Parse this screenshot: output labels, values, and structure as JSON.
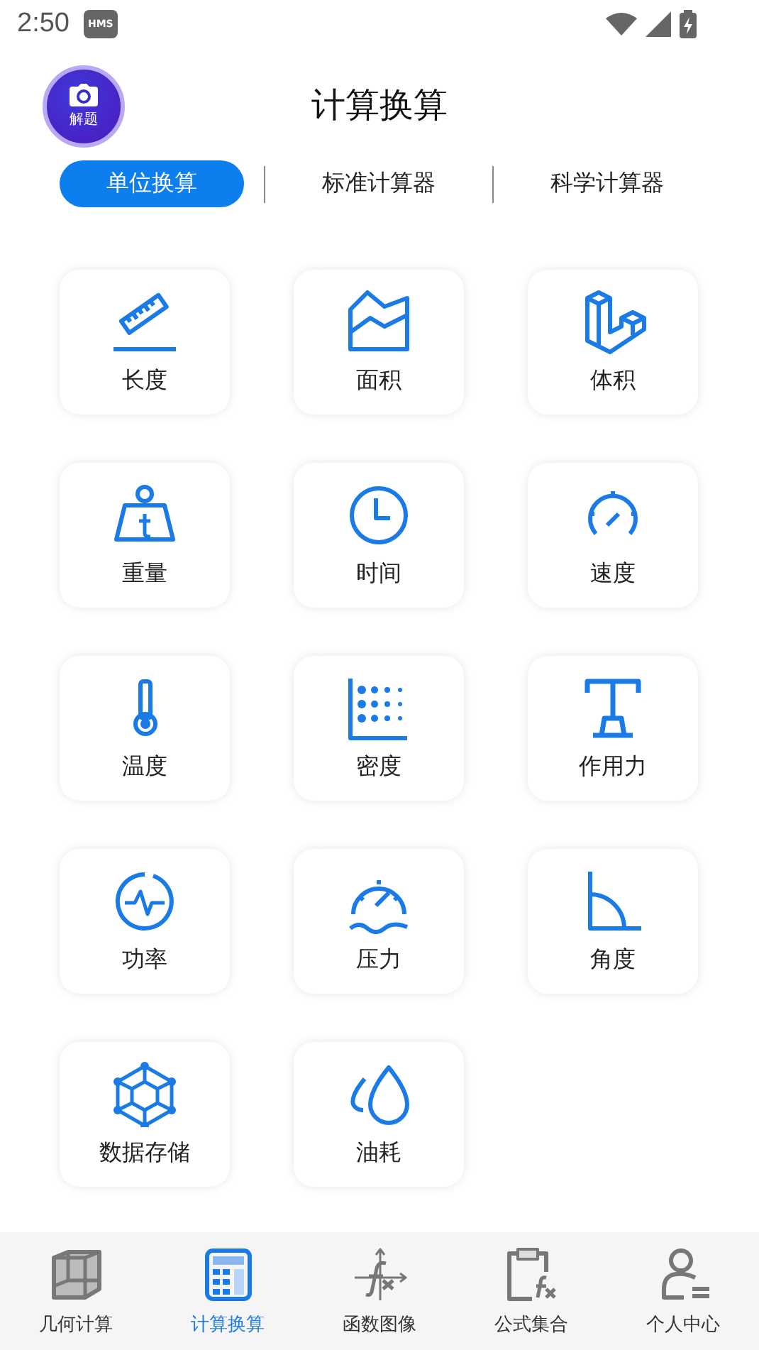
{
  "status_bar": {
    "time": "2:50",
    "badge": "HMS"
  },
  "header": {
    "title": "计算换算",
    "camera_button": {
      "label": "解题"
    }
  },
  "tabs": [
    {
      "label": "单位换算",
      "selected": true
    },
    {
      "label": "标准计算器",
      "selected": false
    },
    {
      "label": "科学计算器",
      "selected": false
    }
  ],
  "tiles": [
    {
      "label": "长度"
    },
    {
      "label": "面积"
    },
    {
      "label": "体积"
    },
    {
      "label": "重量"
    },
    {
      "label": "时间"
    },
    {
      "label": "速度"
    },
    {
      "label": "温度"
    },
    {
      "label": "密度"
    },
    {
      "label": "作用力"
    },
    {
      "label": "功率"
    },
    {
      "label": "压力"
    },
    {
      "label": "角度"
    },
    {
      "label": "数据存储"
    },
    {
      "label": "油耗"
    }
  ],
  "bottom_nav": [
    {
      "label": "几何计算",
      "selected": false
    },
    {
      "label": "计算换算",
      "selected": true
    },
    {
      "label": "函数图像",
      "selected": false
    },
    {
      "label": "公式集合",
      "selected": false
    },
    {
      "label": "个人中心",
      "selected": false
    }
  ]
}
